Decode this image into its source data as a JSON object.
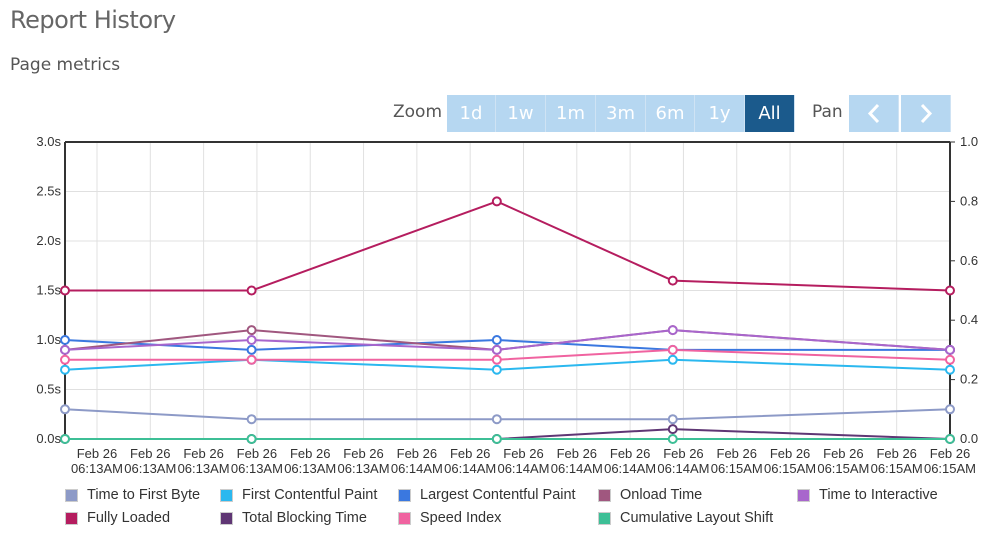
{
  "header": {
    "title": "Report History",
    "subtitle": "Page metrics"
  },
  "range_selector": {
    "zoom_label": "Zoom",
    "buttons": [
      "1d",
      "1w",
      "1m",
      "3m",
      "6m",
      "1y",
      "All"
    ],
    "active": "All",
    "pan_label": "Pan",
    "pan_left_icon": "chevron-left-icon",
    "pan_right_icon": "chevron-right-icon"
  },
  "colors": {
    "active_button": "#1b5a8c",
    "button": "#b6d7f1"
  },
  "chart_data": {
    "type": "line",
    "x_ticks": [
      {
        "date": "Feb 26",
        "time": "06:13AM"
      },
      {
        "date": "Feb 26",
        "time": "06:13AM"
      },
      {
        "date": "Feb 26",
        "time": "06:13AM"
      },
      {
        "date": "Feb 26",
        "time": "06:13AM"
      },
      {
        "date": "Feb 26",
        "time": "06:13AM"
      },
      {
        "date": "Feb 26",
        "time": "06:13AM"
      },
      {
        "date": "Feb 26",
        "time": "06:14AM"
      },
      {
        "date": "Feb 26",
        "time": "06:14AM"
      },
      {
        "date": "Feb 26",
        "time": "06:14AM"
      },
      {
        "date": "Feb 26",
        "time": "06:14AM"
      },
      {
        "date": "Feb 26",
        "time": "06:14AM"
      },
      {
        "date": "Feb 26",
        "time": "06:14AM"
      },
      {
        "date": "Feb 26",
        "time": "06:15AM"
      },
      {
        "date": "Feb 26",
        "time": "06:15AM"
      },
      {
        "date": "Feb 26",
        "time": "06:15AM"
      },
      {
        "date": "Feb 26",
        "time": "06:15AM"
      },
      {
        "date": "Feb 26",
        "time": "06:15AM"
      }
    ],
    "x": [
      "06:12:54",
      "06:13:29",
      "06:14:15",
      "06:14:48",
      "06:15:40"
    ],
    "xlim": [
      "06:12:54",
      "06:15:40"
    ],
    "y_left": {
      "ticks": [
        "0.0s",
        "0.5s",
        "1.0s",
        "1.5s",
        "2.0s",
        "2.5s",
        "3.0s"
      ],
      "ylim": [
        0,
        3
      ]
    },
    "y_right": {
      "ticks": [
        "0.0",
        "0.2",
        "0.4",
        "0.6",
        "0.8",
        "1.0"
      ],
      "ylim": [
        0,
        1
      ]
    },
    "grid": true,
    "legend_position": "bottom",
    "series": [
      {
        "name": "Time to First Byte",
        "color": "#8d9ac7",
        "axis": "left",
        "values": [
          0.3,
          0.2,
          0.2,
          0.2,
          0.3
        ]
      },
      {
        "name": "First Contentful Paint",
        "color": "#2bb8ef",
        "axis": "left",
        "values": [
          0.7,
          0.8,
          0.7,
          0.8,
          0.7
        ]
      },
      {
        "name": "Largest Contentful Paint",
        "color": "#3a78e0",
        "axis": "left",
        "values": [
          1.0,
          0.9,
          1.0,
          0.9,
          0.9
        ]
      },
      {
        "name": "Onload Time",
        "color": "#a0577f",
        "axis": "left",
        "values": [
          0.9,
          1.1,
          0.9,
          1.1,
          0.9
        ]
      },
      {
        "name": "Time to Interactive",
        "color": "#a866cc",
        "axis": "left",
        "values": [
          0.9,
          1.0,
          0.9,
          1.1,
          0.9
        ]
      },
      {
        "name": "Fully Loaded",
        "color": "#b51d5f",
        "axis": "left",
        "values": [
          1.5,
          1.5,
          2.4,
          1.6,
          1.5
        ]
      },
      {
        "name": "Total Blocking Time",
        "color": "#5f3674",
        "axis": "left",
        "values": [
          0,
          0,
          0,
          0.1,
          0
        ]
      },
      {
        "name": "Speed Index",
        "color": "#f063a0",
        "axis": "left",
        "values": [
          0.8,
          0.8,
          0.8,
          0.9,
          0.8
        ]
      },
      {
        "name": "Cumulative Layout Shift",
        "color": "#3dbf96",
        "axis": "right",
        "values": [
          0,
          0,
          0,
          0,
          0
        ]
      }
    ]
  }
}
